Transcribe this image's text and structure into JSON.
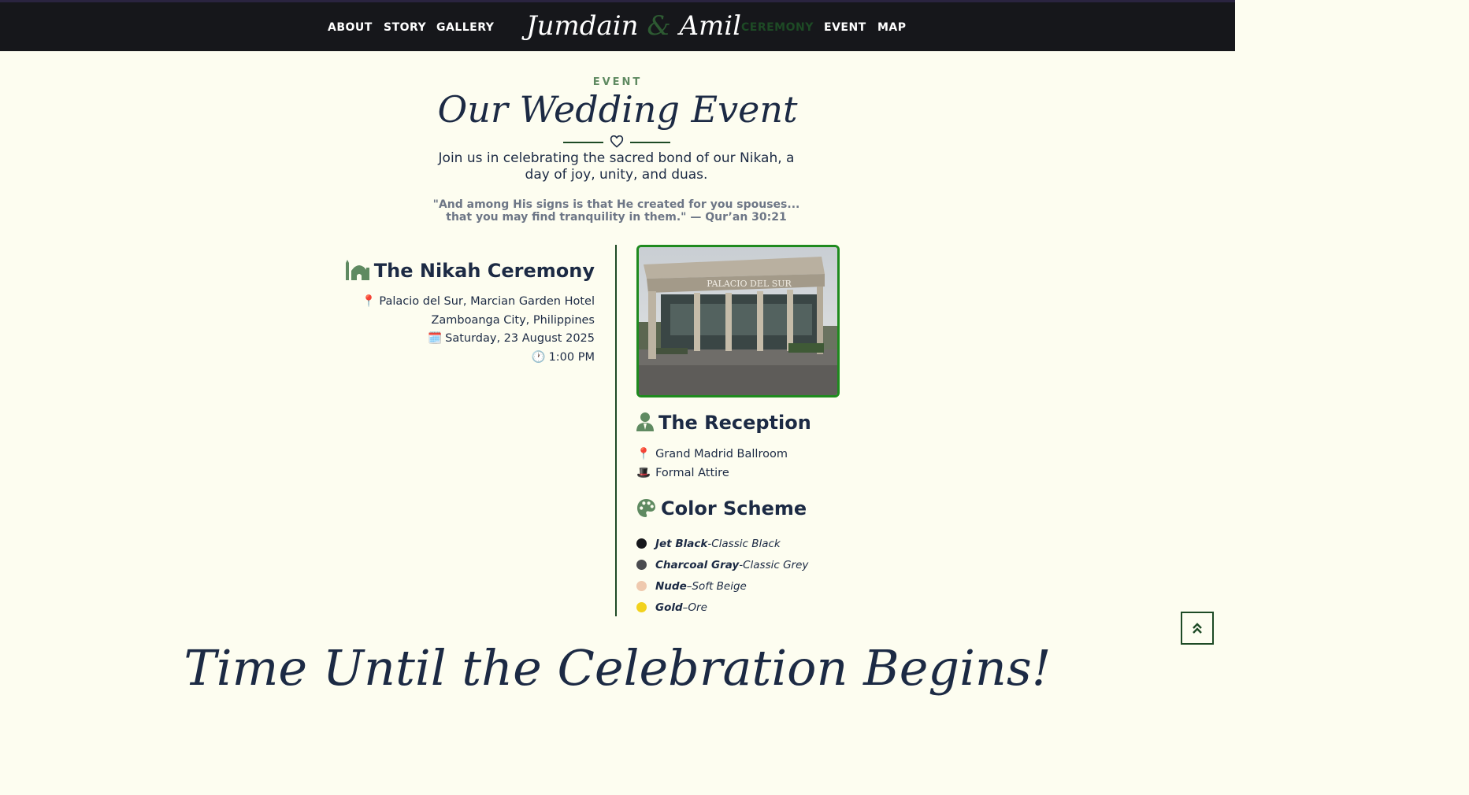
{
  "nav": {
    "links_left": [
      "ABOUT",
      "STORY",
      "GALLERY"
    ],
    "brand_first": "Jumdain",
    "brand_amp": "&",
    "brand_second": "Amil",
    "links_right": [
      "CEREMONY",
      "EVENT",
      "MAP"
    ],
    "active": "CEREMONY"
  },
  "section": {
    "label": "EVENT",
    "title": "Our Wedding Event",
    "intro": "Join us in celebrating the sacred bond of our Nikah, a day of joy, unity, and duas.",
    "verse": "\"And among His signs is that He created for you spouses... that you may find tranquility in them.\" — Qur’an 30:21"
  },
  "nikah": {
    "heading": "The Nikah Ceremony",
    "icon": "mosque-icon",
    "venue_line1": "Palacio del Sur, Marcian Garden Hotel",
    "venue_line2": "Zamboanga City, Philippines",
    "date": "Saturday, 23 August 2025",
    "time": "1:00 PM",
    "emoji_pin": "📍",
    "emoji_calendar": "🗓️",
    "emoji_clock": "🕐"
  },
  "venue_photo": {
    "sign_text": "PALACIO DEL SUR"
  },
  "reception": {
    "heading": "The Reception",
    "icon": "person-icon",
    "location": "Grand Madrid Ballroom",
    "attire": "Formal Attire",
    "emoji_pin": "📍",
    "emoji_hat": "🎩"
  },
  "color_scheme": {
    "heading": "Color Scheme",
    "icon": "palette-icon",
    "items": [
      {
        "name": "Jet Black",
        "sep": " - ",
        "desc": "Classic Black",
        "color": "#16171b"
      },
      {
        "name": "Charcoal Gray",
        "sep": " - ",
        "desc": "Classic Grey",
        "color": "#4a4b4f"
      },
      {
        "name": "Nude",
        "sep": " – ",
        "desc": "Soft Beige",
        "color": "#efc9ae"
      },
      {
        "name": "Gold",
        "sep": " – ",
        "desc": "Ore",
        "color": "#f2d21c"
      }
    ]
  },
  "footer": {
    "script_text": "Time Until the Celebration Begins!"
  },
  "colors": {
    "accent_green": "#1d4a25",
    "soft_green": "#5f8a61",
    "navy": "#1c2a44",
    "background": "#fdfdf0",
    "navbar": "#16171b"
  }
}
